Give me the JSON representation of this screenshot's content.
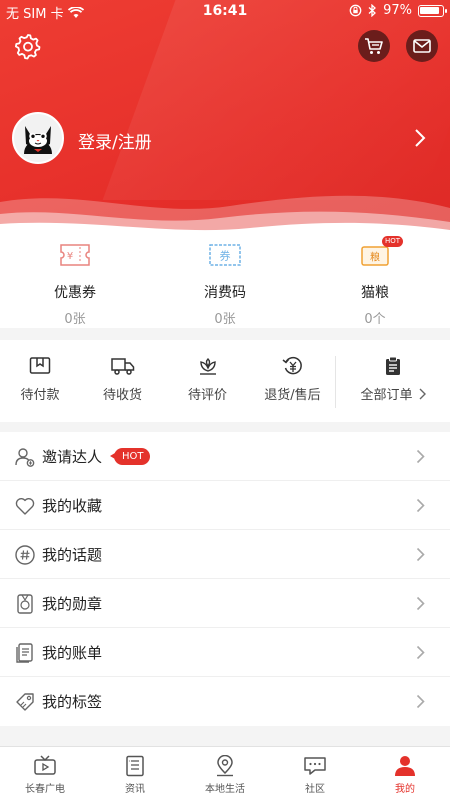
{
  "status_bar": {
    "carrier": "无 SIM 卡",
    "time": "16:41",
    "battery": "97%"
  },
  "header": {
    "login_label": "登录/注册"
  },
  "wallet": [
    {
      "label": "优惠券",
      "value": "0张",
      "icon_text": "¥",
      "color": "#e9837e"
    },
    {
      "label": "消费码",
      "value": "0张",
      "icon_text": "券",
      "color": "#6fb2e6"
    },
    {
      "label": "猫粮",
      "value": "0个",
      "icon_text": "粮",
      "badge": "HOT",
      "color": "#f0a133"
    }
  ],
  "orders": {
    "items": [
      {
        "label": "待付款",
        "icon": "wallet-icon"
      },
      {
        "label": "待收货",
        "icon": "truck-icon"
      },
      {
        "label": "待评价",
        "icon": "review-icon"
      },
      {
        "label": "退货/售后",
        "icon": "refund-icon"
      }
    ],
    "all_label": "全部订单"
  },
  "menu": [
    {
      "label": "邀请达人",
      "icon": "invite-icon",
      "badge": "HOT"
    },
    {
      "label": "我的收藏",
      "icon": "heart-icon"
    },
    {
      "label": "我的话题",
      "icon": "hashtag-icon"
    },
    {
      "label": "我的勋章",
      "icon": "medal-icon"
    },
    {
      "label": "我的账单",
      "icon": "bill-icon"
    },
    {
      "label": "我的标签",
      "icon": "tag-icon"
    }
  ],
  "tabs": [
    {
      "label": "长春广电",
      "icon": "tv-icon"
    },
    {
      "label": "资讯",
      "icon": "news-icon"
    },
    {
      "label": "本地生活",
      "icon": "location-icon"
    },
    {
      "label": "社区",
      "icon": "chat-icon"
    },
    {
      "label": "我的",
      "icon": "person-icon",
      "active": true
    }
  ],
  "colors": {
    "brand_red": "#e4322b",
    "dark_button": "#6b1d1b"
  }
}
